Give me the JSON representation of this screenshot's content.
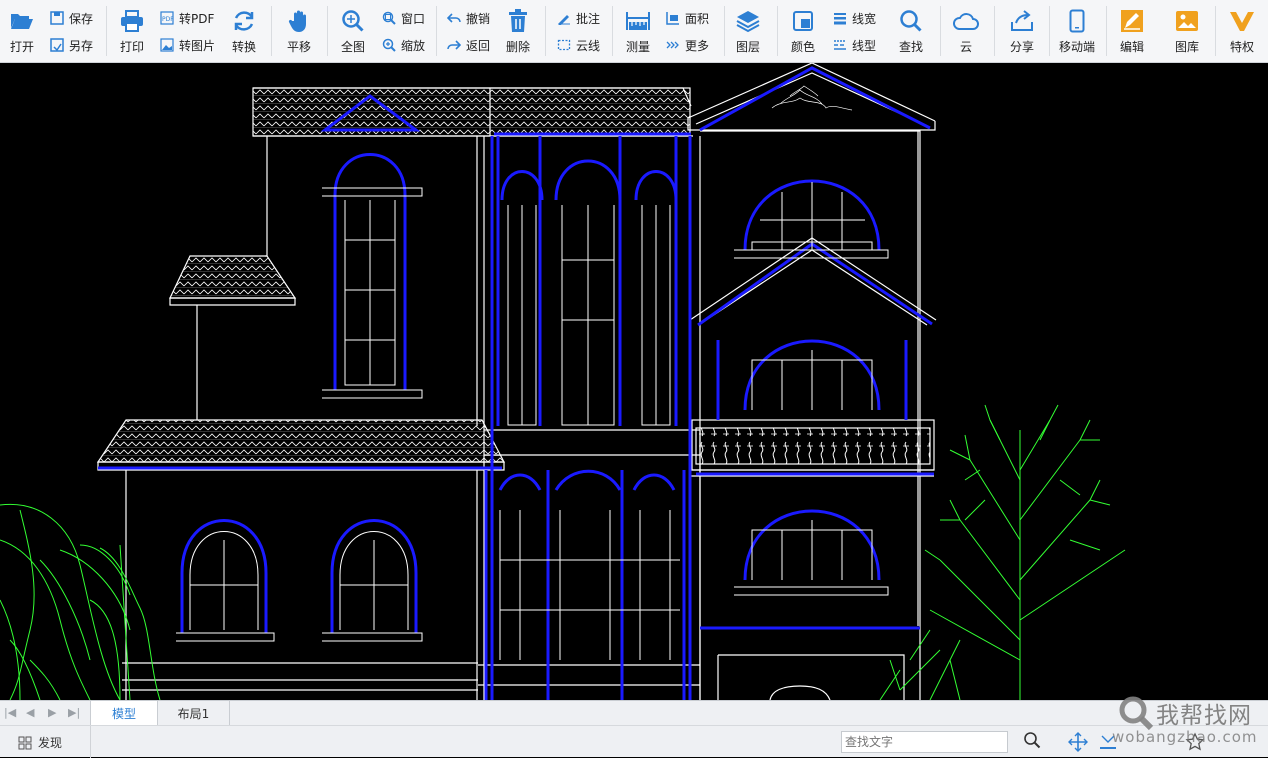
{
  "toolbar": {
    "open": "打开",
    "save": "保存",
    "save_as": "另存",
    "print": "打印",
    "to_pdf": "转PDF",
    "to_image": "转图片",
    "convert": "转换",
    "pan": "平移",
    "full_view": "全图",
    "window": "窗口",
    "zoom": "缩放",
    "undo": "撤销",
    "back": "返回",
    "delete": "删除",
    "annotate": "批注",
    "cloud_line": "云线",
    "measure": "测量",
    "area": "面积",
    "more": "更多",
    "layers": "图层",
    "color": "颜色",
    "line_width": "线宽",
    "line_type": "线型",
    "find": "查找",
    "cloud": "云",
    "share": "分享",
    "mobile": "移动端",
    "edit": "编辑",
    "gallery": "图库",
    "privilege": "特权"
  },
  "colors": {
    "accent": "#2d7fd3",
    "cad_white": "#ffffff",
    "cad_blue": "#1a1aff",
    "cad_green": "#33ff33",
    "toolbar_bg": "#f5f6f8"
  },
  "tabs": {
    "model": "模型",
    "layout1": "布局1"
  },
  "status": {
    "discover": "发现",
    "search_placeholder": "查找文字"
  },
  "watermark": {
    "cn": "我帮找网",
    "en": "wobangzhao.com"
  }
}
